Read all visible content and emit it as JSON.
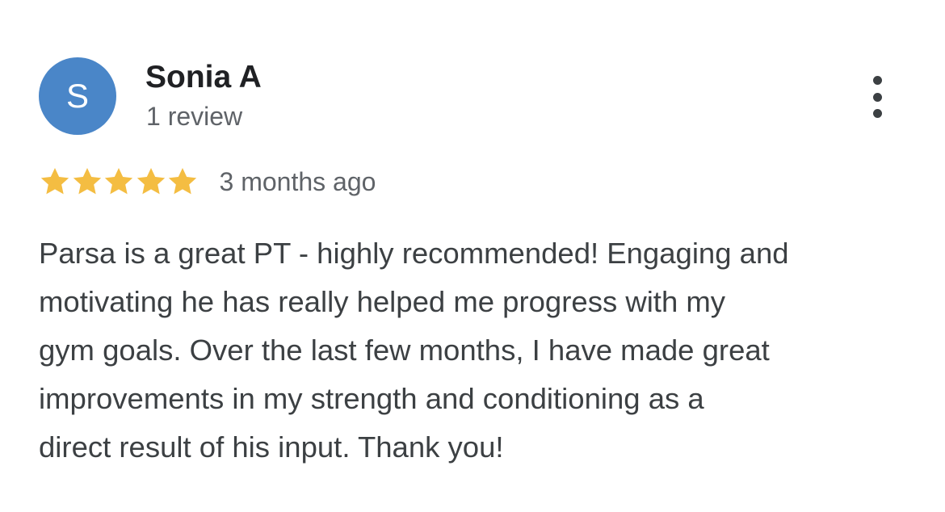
{
  "author": {
    "name": "Sonia A",
    "review_count": "1 review",
    "avatar_initial": "S",
    "avatar_color": "#4a86c8"
  },
  "rating": {
    "stars": 5,
    "max_stars": 5,
    "star_color": "#f4bd42",
    "date": "3 months ago"
  },
  "menu": {
    "icon": "more-vert-icon"
  },
  "review": {
    "lines": [
      "Parsa is a great PT - highly recommended! Engaging and",
      "motivating he has really helped me progress with my",
      "gym goals. Over the last few months, I have made great",
      "improvements in my strength and conditioning as a",
      "direct result of his input. Thank you!"
    ]
  }
}
